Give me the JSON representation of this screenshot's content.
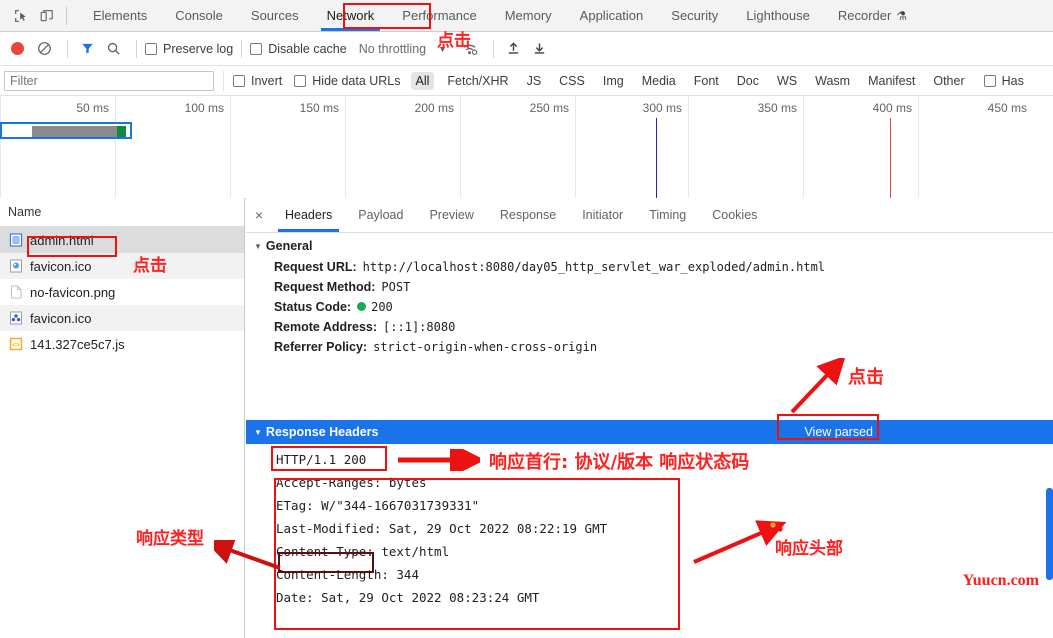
{
  "devtools": {
    "left_icons": [
      {
        "name": "inspect-element-icon",
        "glyph": "cursor-box"
      },
      {
        "name": "device-toolbar-icon",
        "glyph": "device"
      }
    ],
    "tabs": [
      {
        "label": "Elements",
        "active": false
      },
      {
        "label": "Console",
        "active": false
      },
      {
        "label": "Sources",
        "active": false
      },
      {
        "label": "Network",
        "active": true
      },
      {
        "label": "Performance",
        "active": false
      },
      {
        "label": "Memory",
        "active": false
      },
      {
        "label": "Application",
        "active": false
      },
      {
        "label": "Security",
        "active": false
      },
      {
        "label": "Lighthouse",
        "active": false
      },
      {
        "label": "Recorder",
        "active": false
      }
    ]
  },
  "toolbar": {
    "record_label": "record-button",
    "clear_label": "clear-button",
    "filter_toggle_label": "filter-toggle",
    "search_label": "search-button",
    "preserve_log": "Preserve log",
    "disable_cache": "Disable cache",
    "throttling": "No throttling",
    "import_label": "import-har",
    "export_label": "export-har"
  },
  "filterbar": {
    "placeholder": "Filter",
    "value": "",
    "invert": "Invert",
    "hide_data_urls": "Hide data URLs",
    "types": [
      {
        "label": "All",
        "selected": true
      },
      {
        "label": "Fetch/XHR",
        "selected": false
      },
      {
        "label": "JS",
        "selected": false
      },
      {
        "label": "CSS",
        "selected": false
      },
      {
        "label": "Img",
        "selected": false
      },
      {
        "label": "Media",
        "selected": false
      },
      {
        "label": "Font",
        "selected": false
      },
      {
        "label": "Doc",
        "selected": false
      },
      {
        "label": "WS",
        "selected": false
      },
      {
        "label": "Wasm",
        "selected": false
      },
      {
        "label": "Manifest",
        "selected": false
      },
      {
        "label": "Other",
        "selected": false
      }
    ],
    "has_blocked": "Has"
  },
  "timeline": {
    "ticks": [
      "50 ms",
      "100 ms",
      "150 ms",
      "200 ms",
      "250 ms",
      "300 ms",
      "350 ms",
      "400 ms",
      "450 ms"
    ],
    "dom_content_loaded_color": "#2121c8",
    "load_event_color": "#e8453c"
  },
  "requests": {
    "column_header": "Name",
    "rows": [
      {
        "name": "admin.html",
        "icon": "document-icon",
        "selected": true
      },
      {
        "name": "favicon.ico",
        "icon": "image-icon",
        "selected": false
      },
      {
        "name": "no-favicon.png",
        "icon": "blank-file-icon",
        "selected": false
      },
      {
        "name": "favicon.ico",
        "icon": "image-icon",
        "selected": false
      },
      {
        "name": "141.327ce5c7.js",
        "icon": "script-icon",
        "selected": false
      }
    ]
  },
  "detail": {
    "close_label": "×",
    "tabs": [
      {
        "label": "Headers",
        "active": true
      },
      {
        "label": "Payload",
        "active": false
      },
      {
        "label": "Preview",
        "active": false
      },
      {
        "label": "Response",
        "active": false
      },
      {
        "label": "Initiator",
        "active": false
      },
      {
        "label": "Timing",
        "active": false
      },
      {
        "label": "Cookies",
        "active": false
      }
    ],
    "general": {
      "title": "General",
      "rows": [
        {
          "key": "Request URL:",
          "value": "http://localhost:8080/day05_http_servlet_war_exploded/admin.html"
        },
        {
          "key": "Request Method:",
          "value": "POST"
        },
        {
          "key": "Status Code:",
          "value": "200",
          "status_dot": true
        },
        {
          "key": "Remote Address:",
          "value": "[::1]:8080"
        },
        {
          "key": "Referrer Policy:",
          "value": "strict-origin-when-cross-origin"
        }
      ]
    },
    "response_headers": {
      "title": "Response Headers",
      "view_parsed": "View parsed",
      "status_line": "HTTP/1.1 200",
      "lines": [
        "Accept-Ranges: bytes",
        "ETag: W/\"344-1667031739331\"",
        "Last-Modified: Sat, 29 Oct 2022 08:22:19 GMT",
        "Content-Type: text/html",
        "Content-Length: 344",
        "Date: Sat, 29 Oct 2022 08:23:24 GMT"
      ]
    }
  },
  "annotations": {
    "click_network": "点击",
    "click_admin": "点击",
    "click_viewparsed": "点击",
    "status_line_note": "响应首行: 协议/版本 响应状态码",
    "headers_note": "响应头部",
    "content_type_note": "响应类型",
    "watermark": "Yuucn.com",
    "highlight_color": "#ee1111"
  }
}
